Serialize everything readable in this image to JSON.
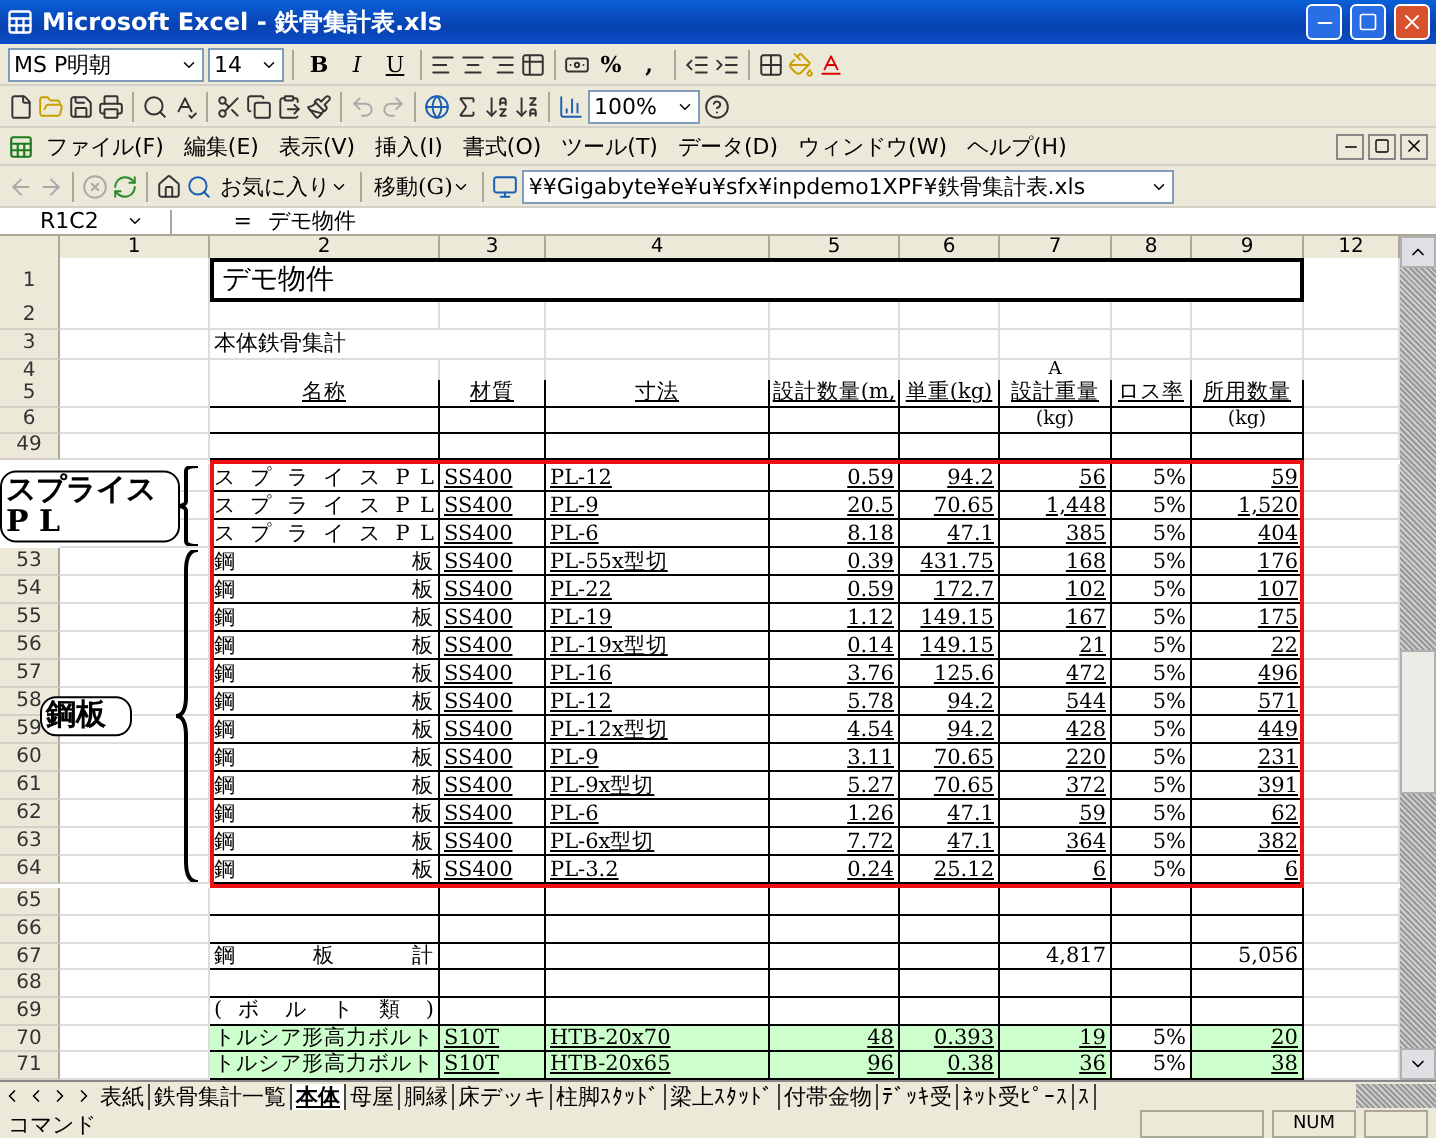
{
  "window": {
    "title": "Microsoft Excel - 鉄骨集計表.xls"
  },
  "formatting_toolbar": {
    "font": "MS P明朝",
    "size": "14",
    "style_buttons": [
      "B",
      "I",
      "U"
    ],
    "number_buttons": [
      "%",
      ","
    ]
  },
  "standard_toolbar": {
    "zoom": "100%"
  },
  "menu": {
    "items": [
      "ファイル(F)",
      "編集(E)",
      "表示(V)",
      "挿入(I)",
      "書式(O)",
      "ツール(T)",
      "データ(D)",
      "ウィンドウ(W)",
      "ヘルプ(H)"
    ]
  },
  "web_toolbar": {
    "favorites": "お気に入り",
    "go": "移動(G)",
    "address": "¥¥Gigabyte¥e¥u¥sfx¥inpdemo1XPF¥鉄骨集計表.xls"
  },
  "formula_bar": {
    "name_box": "R1C2",
    "equals": "=",
    "content": "デモ物件"
  },
  "columns": [
    "1",
    "2",
    "3",
    "4",
    "5",
    "6",
    "7",
    "8",
    "9",
    "12"
  ],
  "rows": [
    {
      "kind": "title",
      "number": "1",
      "text": "デモ物件"
    },
    {
      "kind": "blank",
      "number": "2"
    },
    {
      "kind": "section",
      "number": "3",
      "text": "本体鉄骨集計"
    },
    {
      "kind": "note",
      "number": "4",
      "text": "A"
    },
    {
      "kind": "header",
      "number": "5",
      "cells": [
        "名称",
        "材質",
        "寸法",
        "設計数量(m,",
        "単重(kg)",
        "設計重量",
        "ロス率",
        "所用数量"
      ]
    },
    {
      "kind": "units",
      "number": "6",
      "weight_unit": "(kg)",
      "required_unit": "(kg)"
    },
    {
      "kind": "empty",
      "number": "49"
    },
    {
      "kind": "marked",
      "groups": [
        {
          "label": "スプライス P L",
          "items": [
            {
              "name": "ス プ ラ イ ス P L",
              "material": "SS400",
              "size": "PL-12",
              "quantity": "0.59",
              "unit_weight": "94.2",
              "weight": "56",
              "loss": "5%",
              "required": "59"
            },
            {
              "name": "ス プ ラ イ ス P L",
              "material": "SS400",
              "size": "PL-9",
              "quantity": "20.5",
              "unit_weight": "70.65",
              "weight": "1,448",
              "loss": "5%",
              "required": "1,520"
            },
            {
              "name": "ス プ ラ イ ス P L",
              "material": "SS400",
              "size": "PL-6",
              "quantity": "8.18",
              "unit_weight": "47.1",
              "weight": "385",
              "loss": "5%",
              "required": "404"
            }
          ]
        },
        {
          "label": "鋼板",
          "items": [
            {
              "number": "53",
              "name": "鋼 板",
              "material": "SS400",
              "size": "PL-55x型切",
              "quantity": "0.39",
              "unit_weight": "431.75",
              "weight": "168",
              "loss": "5%",
              "required": "176"
            },
            {
              "number": "54",
              "name": "鋼 板",
              "material": "SS400",
              "size": "PL-22",
              "quantity": "0.59",
              "unit_weight": "172.7",
              "weight": "102",
              "loss": "5%",
              "required": "107"
            },
            {
              "number": "55",
              "name": "鋼 板",
              "material": "SS400",
              "size": "PL-19",
              "quantity": "1.12",
              "unit_weight": "149.15",
              "weight": "167",
              "loss": "5%",
              "required": "175"
            },
            {
              "number": "56",
              "name": "鋼 板",
              "material": "SS400",
              "size": "PL-19x型切",
              "quantity": "0.14",
              "unit_weight": "149.15",
              "weight": "21",
              "loss": "5%",
              "required": "22"
            },
            {
              "number": "57",
              "name": "鋼 板",
              "material": "SS400",
              "size": "PL-16",
              "quantity": "3.76",
              "unit_weight": "125.6",
              "weight": "472",
              "loss": "5%",
              "required": "496"
            },
            {
              "number": "58",
              "name": "鋼 板",
              "material": "SS400",
              "size": "PL-12",
              "quantity": "5.78",
              "unit_weight": "94.2",
              "weight": "544",
              "loss": "5%",
              "required": "571"
            },
            {
              "number": "59",
              "name": "鋼 板",
              "material": "SS400",
              "size": "PL-12x型切",
              "quantity": "4.54",
              "unit_weight": "94.2",
              "weight": "428",
              "loss": "5%",
              "required": "449"
            },
            {
              "number": "60",
              "name": "鋼 板",
              "material": "SS400",
              "size": "PL-9",
              "quantity": "3.11",
              "unit_weight": "70.65",
              "weight": "220",
              "loss": "5%",
              "required": "231"
            },
            {
              "number": "61",
              "name": "鋼 板",
              "material": "SS400",
              "size": "PL-9x型切",
              "quantity": "5.27",
              "unit_weight": "70.65",
              "weight": "372",
              "loss": "5%",
              "required": "391"
            },
            {
              "number": "62",
              "name": "鋼 板",
              "material": "SS400",
              "size": "PL-6",
              "quantity": "1.26",
              "unit_weight": "47.1",
              "weight": "59",
              "loss": "5%",
              "required": "62"
            },
            {
              "number": "63",
              "name": "鋼 板",
              "material": "SS400",
              "size": "PL-6x型切",
              "quantity": "7.72",
              "unit_weight": "47.1",
              "weight": "364",
              "loss": "5%",
              "required": "382"
            },
            {
              "number": "64",
              "name": "鋼 板",
              "material": "SS400",
              "size": "PL-3.2",
              "quantity": "0.24",
              "unit_weight": "25.12",
              "weight": "6",
              "loss": "5%",
              "required": "6"
            }
          ]
        }
      ]
    },
    {
      "kind": "empty",
      "number": "65"
    },
    {
      "kind": "empty",
      "number": "66"
    },
    {
      "kind": "total",
      "number": "67",
      "name": "鋼 板 計",
      "weight": "4,817",
      "required": "5,056"
    },
    {
      "kind": "empty",
      "number": "68"
    },
    {
      "kind": "group_title",
      "number": "69",
      "name": "( ボ ル ト 類 )"
    },
    {
      "kind": "item",
      "number": "70",
      "highlighted": true,
      "name": "トルシア形高力ボルト",
      "material": "S10T",
      "size": "HTB-20x70",
      "quantity": "48",
      "unit_weight": "0.393",
      "weight": "19",
      "loss": "5%",
      "required": "20"
    },
    {
      "kind": "item",
      "number": "71",
      "highlighted": true,
      "name": "トルシア形高力ボルト",
      "material": "S10T",
      "size": "HTB-20x65",
      "quantity": "96",
      "unit_weight": "0.38",
      "weight": "36",
      "loss": "5%",
      "required": "38"
    }
  ],
  "sheet_tabs": [
    {
      "label": "表紙",
      "selected": false
    },
    {
      "label": "鉄骨集計一覧",
      "selected": false
    },
    {
      "label": "本体",
      "selected": true
    },
    {
      "label": "母屋",
      "selected": false
    },
    {
      "label": "胴縁",
      "selected": false
    },
    {
      "label": "床デッキ",
      "selected": false
    },
    {
      "label": "柱脚ｽﾀｯﾄﾞ",
      "selected": false
    },
    {
      "label": "梁上ｽﾀｯﾄﾞ",
      "selected": false
    },
    {
      "label": "付帯金物",
      "selected": false
    },
    {
      "label": "ﾃﾞｯｷ受",
      "selected": false
    },
    {
      "label": "ﾈｯﾄ受ﾋﾟｰｽ",
      "selected": false
    },
    {
      "label": "ｽ",
      "selected": false
    }
  ],
  "status_bar": {
    "mode": "コマンド",
    "num": "NUM"
  }
}
